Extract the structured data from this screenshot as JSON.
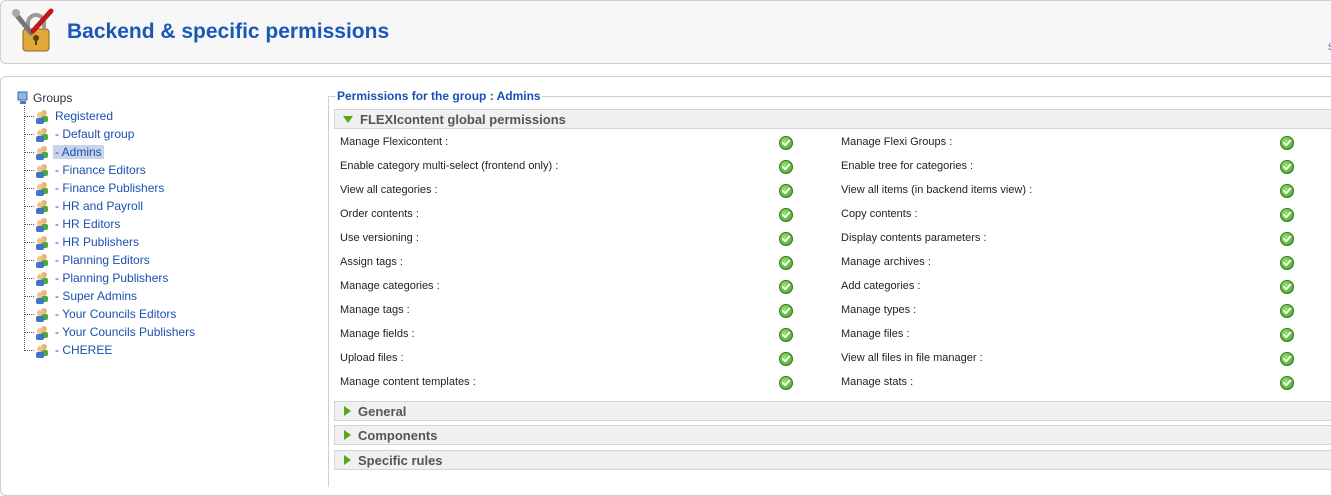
{
  "header": {
    "title": "Backend & specific permissions",
    "edge_link": "S",
    "icon": "tools-lock-icon"
  },
  "tree": {
    "root_label": "Groups",
    "items": [
      {
        "label": "Registered",
        "selected": false
      },
      {
        "label": "- Default group",
        "selected": false
      },
      {
        "label": "- Admins",
        "selected": true
      },
      {
        "label": "- Finance Editors",
        "selected": false
      },
      {
        "label": "- Finance Publishers",
        "selected": false
      },
      {
        "label": "- HR and Payroll",
        "selected": false
      },
      {
        "label": "- HR Editors",
        "selected": false
      },
      {
        "label": "- HR Publishers",
        "selected": false
      },
      {
        "label": "- Planning Editors",
        "selected": false
      },
      {
        "label": "- Planning Publishers",
        "selected": false
      },
      {
        "label": "- Super Admins",
        "selected": false
      },
      {
        "label": "- Your Councils Editors",
        "selected": false
      },
      {
        "label": "- Your Councils Publishers",
        "selected": false
      },
      {
        "label": "- CHEREE",
        "selected": false
      }
    ]
  },
  "permissions": {
    "legend": "Permissions for the group : Admins",
    "global_panel_title": "FLEXIcontent global permissions",
    "rows": [
      {
        "left": "Manage Flexicontent :",
        "right": "Manage Flexi Groups :"
      },
      {
        "left": "Enable category multi-select (frontend only) :",
        "right": "Enable tree for categories :"
      },
      {
        "left": "View all categories :",
        "right": "View all items (in backend items view) :"
      },
      {
        "left": "Order contents :",
        "right": "Copy contents :"
      },
      {
        "left": "Use versioning :",
        "right": "Display contents parameters :"
      },
      {
        "left": "Assign tags :",
        "right": "Manage archives :"
      },
      {
        "left": "Manage categories :",
        "right": "Add categories :"
      },
      {
        "left": "Manage tags :",
        "right": "Manage types :"
      },
      {
        "left": "Manage fields :",
        "right": "Manage files :"
      },
      {
        "left": "Upload files :",
        "right": "View all files in file manager :"
      },
      {
        "left": "Manage content templates :",
        "right": "Manage stats :"
      }
    ],
    "collapsed_panels": [
      "General",
      "Components",
      "Specific rules"
    ],
    "check_color": "#3f9e23",
    "expanded_arrow_color": "#58a81c"
  }
}
